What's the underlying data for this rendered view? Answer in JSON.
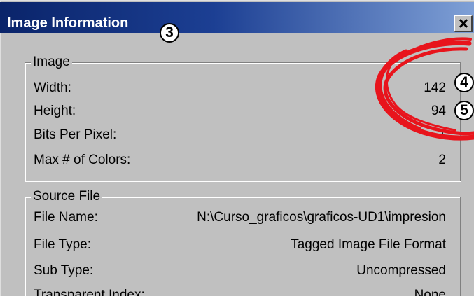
{
  "window": {
    "title": "Image Information"
  },
  "markers": [
    "3",
    "4",
    "5"
  ],
  "image_group": {
    "label": "Image",
    "rows": [
      {
        "name": "Width:",
        "value": "142"
      },
      {
        "name": "Height:",
        "value": "94"
      },
      {
        "name": "Bits Per Pixel:",
        "value": "1"
      },
      {
        "name": "Max # of Colors:",
        "value": "2"
      }
    ]
  },
  "source_group": {
    "label": "Source File",
    "rows": [
      {
        "name": "File Name:",
        "value": "N:\\Curso_graficos\\graficos-UD1\\impresion"
      },
      {
        "name": "File Type:",
        "value": "Tagged Image File Format"
      },
      {
        "name": "Sub Type:",
        "value": "Uncompressed"
      },
      {
        "name": "Transparent Index:",
        "value": "None"
      }
    ]
  },
  "annotation_color": "#e8141c",
  "icons": {
    "close": "close-icon"
  }
}
